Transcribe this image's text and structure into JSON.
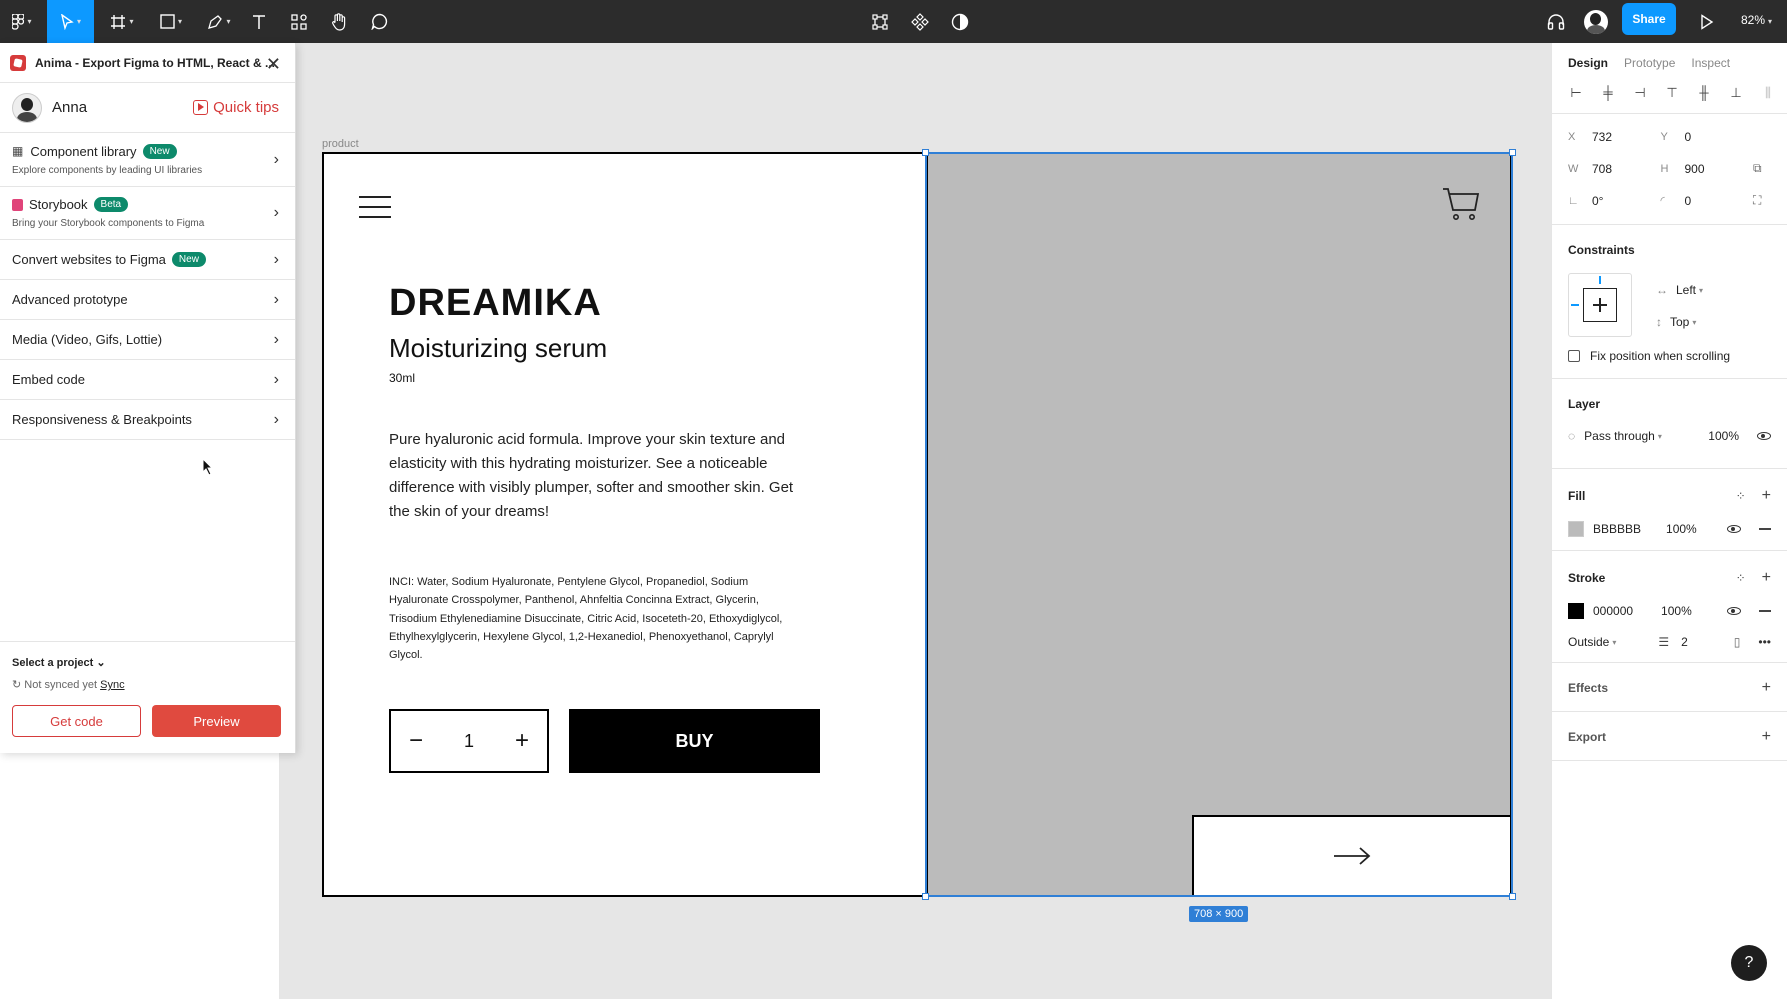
{
  "toolbar": {
    "tools": [
      "figma-menu",
      "move",
      "frame",
      "shape",
      "pen",
      "text",
      "resources",
      "hand",
      "comment"
    ],
    "center_tools": [
      "transform",
      "component",
      "contrast"
    ],
    "share_label": "Share",
    "zoom_label": "82%"
  },
  "plugin": {
    "title": "Anima - Export Figma to HTML, React & ...",
    "user_name": "Anna",
    "quick_tips_label": "Quick tips",
    "menu": [
      {
        "title": "Component library",
        "badge": "New",
        "subtitle": "Explore components by leading UI libraries"
      },
      {
        "title": "Storybook",
        "badge": "Beta",
        "subtitle": "Bring your Storybook components to Figma"
      },
      {
        "title": "Convert websites to Figma",
        "badge": "New"
      },
      {
        "title": "Advanced prototype"
      },
      {
        "title": "Media (Video, Gifs, Lottie)"
      },
      {
        "title": "Embed code"
      },
      {
        "title": "Responsiveness & Breakpoints"
      }
    ],
    "select_project_label": "Select a project",
    "not_synced_label": "Not synced yet",
    "sync_label": "Sync",
    "get_code_label": "Get code",
    "preview_label": "Preview"
  },
  "canvas": {
    "frame_label": "product",
    "brand": "DREAMIKA",
    "product_name": "Moisturizing serum",
    "volume": "30ml",
    "description": "Pure hyaluronic acid formula. Improve your skin texture and elasticity with this hydrating moisturizer. See a noticeable difference with visibly plumper, softer and smoother skin. Get the skin of your dreams!",
    "inci": "INCI: Water, Sodium Hyaluronate, Pentylene Glycol, Propanediol, Sodium Hyaluronate Crosspolymer, Panthenol, Ahnfeltia Concinna Extract, Glycerin, Trisodium Ethylenediamine Disuccinate, Citric Acid, Isoceteth-20, Ethoxydiglycol, Ethylhexylglycerin, Hexylene Glycol, 1,2-Hexanediol, Phenoxyethanol, Caprylyl Glycol.",
    "qty_minus": "−",
    "qty_value": "1",
    "qty_plus": "+",
    "buy_label": "BUY",
    "image_fill": "#BBBBBB",
    "selection_size": "708 × 900"
  },
  "design_panel": {
    "tabs": [
      "Design",
      "Prototype",
      "Inspect"
    ],
    "x_label": "X",
    "x": "732",
    "y_label": "Y",
    "y": "0",
    "w_label": "W",
    "w": "708",
    "h_label": "H",
    "h": "900",
    "rotation": "0°",
    "radius": "0",
    "constraints_title": "Constraints",
    "constraint_h": "Left",
    "constraint_v": "Top",
    "fix_position_label": "Fix position when scrolling",
    "layer_title": "Layer",
    "blend_mode": "Pass through",
    "layer_opacity": "100%",
    "fill_title": "Fill",
    "fill_hex": "BBBBBB",
    "fill_opacity": "100%",
    "fill_color": "#bbbbbb",
    "stroke_title": "Stroke",
    "stroke_hex": "000000",
    "stroke_opacity": "100%",
    "stroke_color": "#000000",
    "stroke_position": "Outside",
    "stroke_weight": "2",
    "effects_title": "Effects",
    "export_title": "Export"
  },
  "help_label": "?"
}
